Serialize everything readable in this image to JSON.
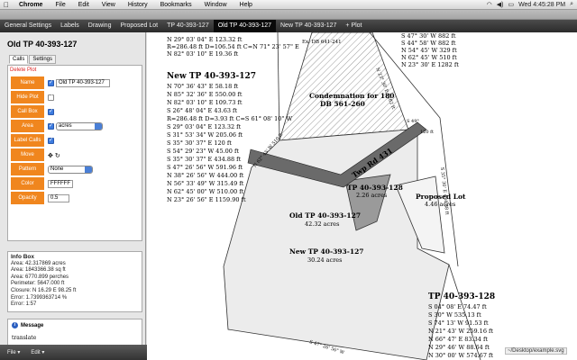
{
  "menubar": {
    "app": "Chrome",
    "items": [
      "File",
      "Edit",
      "View",
      "History",
      "Bookmarks",
      "Window",
      "Help"
    ],
    "clock": "Wed 4:45:28 PM"
  },
  "tabs": [
    {
      "label": "General Settings"
    },
    {
      "label": "Labels"
    },
    {
      "label": "Drawing"
    },
    {
      "label": "Proposed Lot"
    },
    {
      "label": "TP 40-393-127"
    },
    {
      "label": "Old TP 40-393-127",
      "active": true
    },
    {
      "label": "New TP 40-393-127"
    },
    {
      "label": "+ Plot"
    }
  ],
  "left": {
    "title": "Old TP 40-393-127",
    "subtabs": [
      "Calls",
      "Settings"
    ],
    "delete_label": "Delete Plot",
    "rows": {
      "name": {
        "label": "Name",
        "value": "Old TP 40-393-127"
      },
      "hide": {
        "label": "Hide Plot"
      },
      "callbox": {
        "label": "Call Box"
      },
      "area": {
        "label": "Area",
        "unit": "acres"
      },
      "labelcalls": {
        "label": "Label Calls"
      },
      "move": {
        "label": "Move"
      },
      "pattern": {
        "label": "Pattern",
        "value": "None"
      },
      "color": {
        "label": "Color",
        "value": "FFFFFF"
      },
      "opacity": {
        "label": "Opacity",
        "value": "0.5"
      }
    }
  },
  "infobox": {
    "title": "Info Box",
    "lines": [
      "Area: 42.317869 acres",
      "Area: 1843366.38 sq ft",
      "Area: 6770.899 perches",
      "Perimeter: 5647.000 ft",
      "Closure: N 16.29 E 98.25 ft",
      "Error: 1.7399363714 %",
      "Error: 1:57"
    ]
  },
  "message": {
    "title": "Message",
    "text": "translate"
  },
  "bottom": {
    "file": "File",
    "edit": "Edit"
  },
  "file_path": "~/Desktop/example.svg",
  "drawing": {
    "top_calls": [
      "N 29° 03' 04\" E 123.32 ft",
      "R=286.48 ft D=106.54 ft C=N 71° 23' 57\" E",
      "N 82° 03' 10\" E 19.36 ft"
    ],
    "new_title": "New TP 40-393-127",
    "new_calls": [
      "N 70° 36' 43\" E 58.18 ft",
      "N 85° 32' 36\" E 550.00 ft",
      "N 82° 03' 10\" E 109.73 ft",
      "S 26° 48' 04\" E 43.63 ft",
      "R=286.48 ft D=3.93 ft C=S 61° 08' 10\" W",
      "S 29° 03' 04\" E 123.32 ft",
      "S 31° 53' 34\" W 205.06 ft",
      "S 35° 30' 37\" E 120 ft",
      "S 54° 29' 23\" W 45.00 ft",
      "S 35° 30' 37\" E 434.88 ft",
      "S 47° 26' 56\" W 591.96 ft",
      "N 38° 26' 56\" W 444.00 ft",
      "N 56° 33' 49\" W 315.49 ft",
      "N 62° 45' 00\" W 510.00 ft",
      "N 23° 26' 56\" E 1159.90 ft"
    ],
    "right_top_calls": [
      "S 47° 30' W 882 ft",
      "S 44° 58' W 882 ft",
      "N 54° 45' W 329 ft",
      "N 62° 45' W 510 ft",
      "N 23° 30' E 1282 ft"
    ],
    "ex_db": "Ex. DB 641-241",
    "condemnation": [
      "Condemnation for 180",
      "DB 561-260"
    ],
    "road": "Twp Rd 431",
    "tp128_small": "TP 40-393-128",
    "tp128_small_area": "2.26 acres",
    "proposed": "Proposed Lot",
    "proposed_area": "4.46 acres",
    "old_label": "Old TP 40-393-127",
    "old_area": "42.32 acres",
    "new_label": "New TP 40-393-127",
    "new_area": "30.24 acres",
    "tp128_title": "TP 40-393-128",
    "tp128_calls": [
      "S 04° 08' E 74.47 ft",
      "S 30° W 535.13 ft",
      "S 74° 13' W 91.53 ft",
      "N 21° 43' W 259.16 ft",
      "N 66° 47' E 83.34 ft",
      "N 29° 46' W 88.64 ft",
      "N 30° 00' W 574.67 ft"
    ],
    "edge_labels": [
      "N 23° 30' E 1282 ft",
      "S 35° 30' E 434.88 ft",
      "N 62° 45' W 510 ft",
      "S 47° 26' 56\" W",
      "120 ft",
      "S 49°"
    ]
  }
}
